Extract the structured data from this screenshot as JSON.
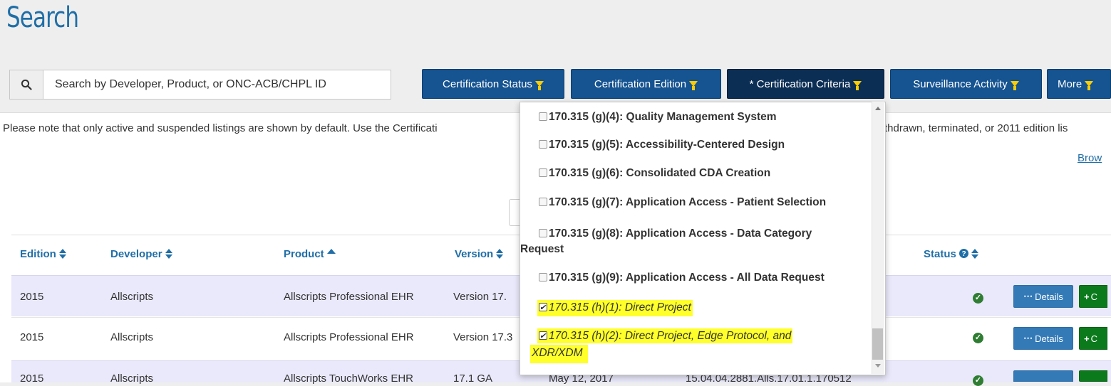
{
  "page": {
    "title": "Search"
  },
  "search": {
    "placeholder": "Search by Developer, Product, or ONC-ACB/CHPL ID"
  },
  "filters": [
    {
      "label": "Certification Status"
    },
    {
      "label": "Certification Edition"
    },
    {
      "label": "* Certification Criteria"
    },
    {
      "label": "Surveillance Activity"
    },
    {
      "label": "More"
    }
  ],
  "notice": {
    "left": "Please note that only active and suspended listings are shown by default. Use the Certificati",
    "right": "thdrawn, terminated, or 2011 edition lis",
    "browse": "Brow"
  },
  "table": {
    "headers": [
      "Edition",
      "Developer",
      "Product",
      "Version",
      "Status"
    ],
    "rows": [
      {
        "edition": "2015",
        "developer": "Allscripts",
        "product": "Allscripts Professional EHR",
        "version": "Version 17.",
        "details": "Details",
        "compare": "C"
      },
      {
        "edition": "2015",
        "developer": "Allscripts",
        "product": "Allscripts Professional EHR",
        "version": "Version 17.3",
        "details": "Details",
        "compare": "C"
      },
      {
        "edition": "2015",
        "developer": "Allscripts",
        "product": "Allscripts TouchWorks EHR",
        "version": "17.1 GA",
        "date": "May 12, 2017",
        "id": "15.04.04.2881.Alls.17.01.1.170512"
      }
    ]
  },
  "criteria_dropdown": {
    "options": [
      {
        "label": "170.315 (g)(4): Quality Management System",
        "checked": false
      },
      {
        "label": "170.315 (g)(5): Accessibility-Centered Design",
        "checked": false
      },
      {
        "label": "170.315 (g)(6): Consolidated CDA Creation",
        "checked": false
      },
      {
        "label": "170.315 (g)(7): Application Access - Patient Selection",
        "checked": false
      },
      {
        "label_line1": "170.315 (g)(8): Application Access - Data Category",
        "label_line2": "Request",
        "checked": false
      },
      {
        "label": "170.315 (g)(9): Application Access - All Data Request",
        "checked": false
      },
      {
        "label": "170.315 (h)(1): Direct Project",
        "checked": true
      },
      {
        "label_line1": "170.315 (h)(2): Direct Project, Edge Protocol, and",
        "label_line2": "XDR/XDM",
        "checked": true
      }
    ]
  },
  "colors": {
    "brand_blue": "#1f6ea7",
    "button_blue": "#155391",
    "highlight": "#ffff2a",
    "success": "#2e7d32",
    "compare_green": "#0b7a1c"
  }
}
